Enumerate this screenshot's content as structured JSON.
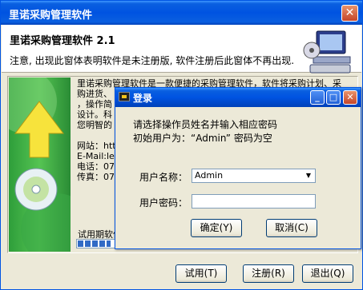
{
  "main_window": {
    "title": "里诺采购管理软件",
    "close_symbol": "✕"
  },
  "header": {
    "app_title": "里诺采购管理软件 2.1",
    "notice": "注意, 出现此窗体表明软件是未注册版, 软件注册后此窗体不再出现."
  },
  "about": {
    "lines": [
      "    里诺采购管理软件是一款便捷的采购管理软件，软件将采购计划、采",
      "购进货、",
      "，操作简",
      "设计。科",
      "您明智的",
      "",
      "网站：htt",
      "E-Mail:le",
      "电话：071",
      "传真：071"
    ]
  },
  "trial": {
    "label": "试用期软件",
    "progress": 0.9
  },
  "buttons": {
    "trial": "试用(T)",
    "register": "注册(R)",
    "exit": "退出(Q)"
  },
  "login_dialog": {
    "title": "登录",
    "minimize_symbol": "_",
    "maximize_symbol": "□",
    "close_symbol": "✕",
    "prompt_line1": "请选择操作员姓名并输入相应密码",
    "prompt_line2": "初始用户为：“Admin” 密码为空",
    "username_label": "用户名称：",
    "username_value": "Admin",
    "password_label": "用户密码：",
    "password_value": "",
    "ok_button": "确定(Y)",
    "cancel_button": "取消(C)"
  },
  "colors": {
    "title_bar": "#0053e1",
    "art_green": "#55c453",
    "progress": "#316ac5"
  }
}
